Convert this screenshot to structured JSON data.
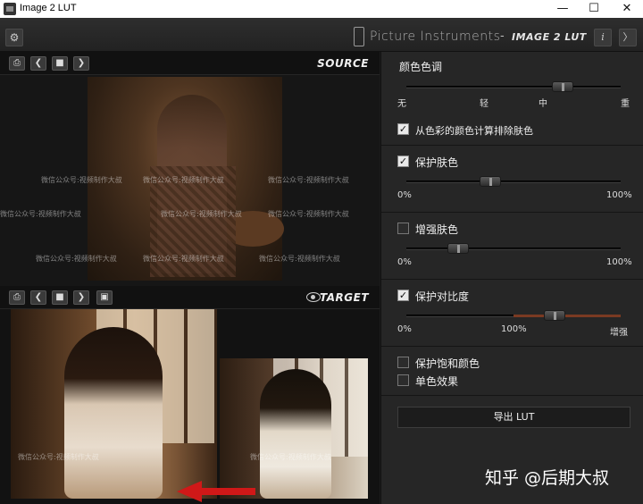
{
  "window": {
    "title": "Image 2 LUT",
    "minimize": "—",
    "maximize": "☐",
    "close": "✕"
  },
  "header": {
    "gear": "⚙",
    "brand_name": "Picture Instruments",
    "brand_dash": "-",
    "product_name": "IMAGE 2 LUT",
    "info": "i",
    "collapse": "〉"
  },
  "source": {
    "title": "SOURCE",
    "buttons": [
      "⎙",
      "❮",
      "■",
      "❯"
    ]
  },
  "target": {
    "title": "TARGET",
    "buttons": [
      "⎙",
      "❮",
      "■",
      "❯",
      "▣"
    ]
  },
  "watermark": "微信公众号:视频制作大叔",
  "settings": {
    "color_tone": {
      "label": "颜色色调",
      "value_fraction": 0.73,
      "ticks": [
        "无",
        "轻",
        "中",
        "重"
      ],
      "exclude_skin_label": "从色彩的颜色计算排除肤色",
      "exclude_skin_checked": true
    },
    "protect_skin": {
      "label": "保护肤色",
      "checked": true,
      "value_fraction": 0.39,
      "min": "0%",
      "max": "100%"
    },
    "enhance_skin": {
      "label": "增强肤色",
      "checked": false,
      "value_fraction": 0.24,
      "min": "0%",
      "max": "100%"
    },
    "protect_contrast": {
      "label": "保护对比度",
      "checked": true,
      "value_fraction": 0.69,
      "min": "0%",
      "mid": "100%",
      "max": "增强"
    },
    "protect_saturation": {
      "label": "保护饱和颜色",
      "checked": false
    },
    "monochrome": {
      "label": "单色效果",
      "checked": false
    },
    "export_label": "导出 LUT"
  },
  "overlay_credit": "知乎 @后期大叔",
  "colors": {
    "accent_track": "#7a3a22",
    "arrow": "#d01818"
  }
}
